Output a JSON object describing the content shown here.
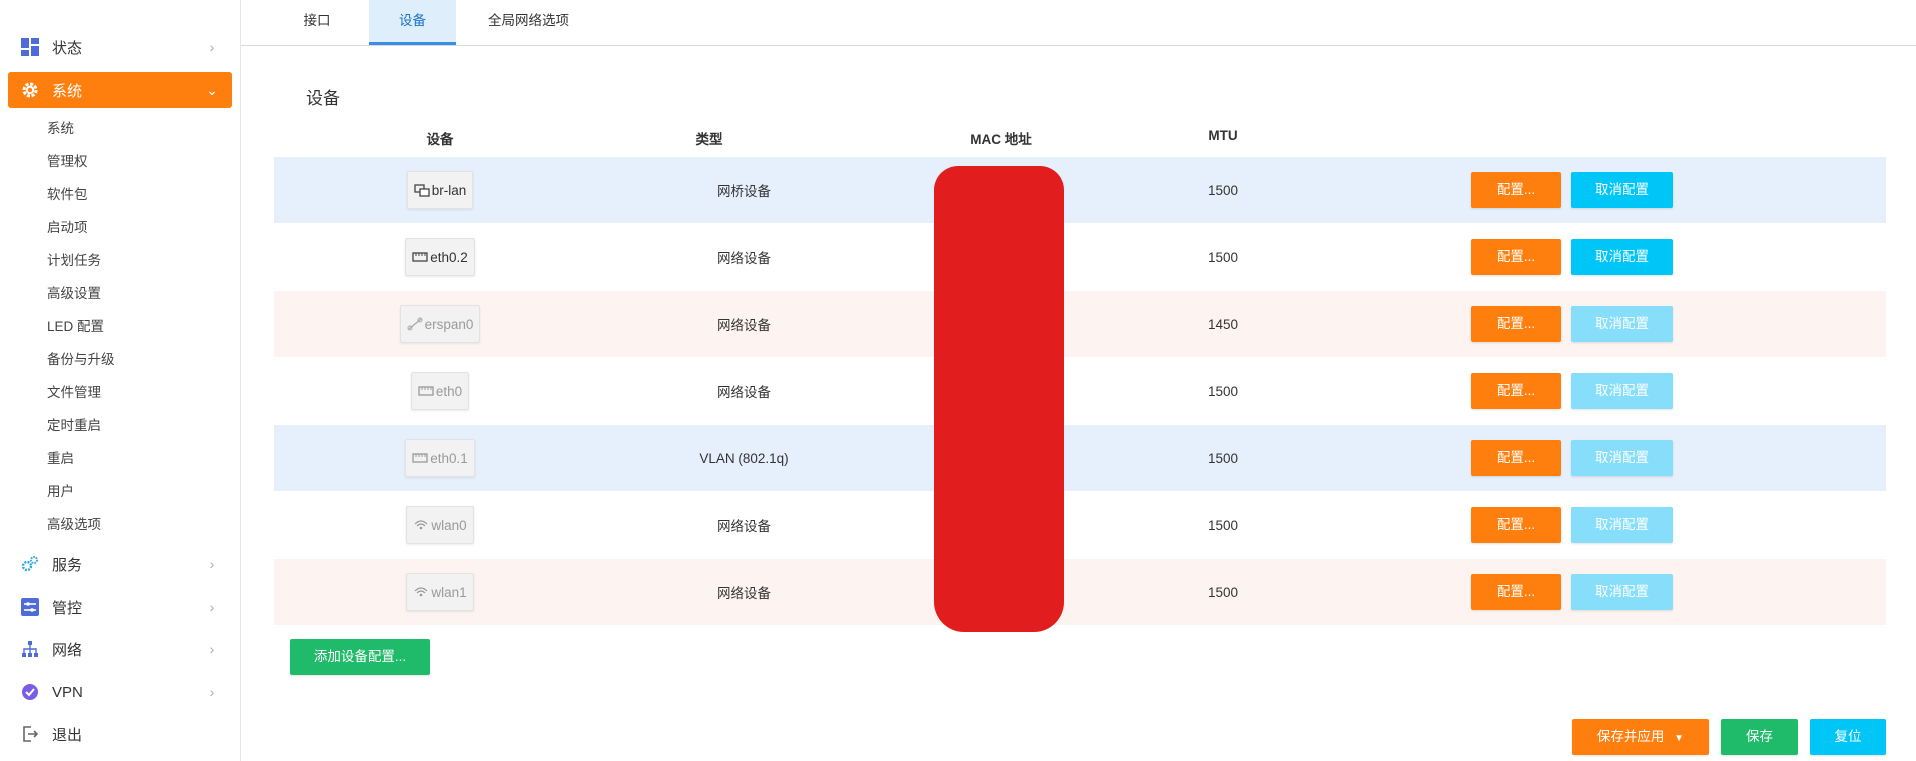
{
  "sidebar": {
    "top_items": [
      {
        "label": "状态",
        "icon": "dashboard-icon"
      },
      {
        "label": "系统",
        "icon": "gear-icon",
        "active": true
      },
      {
        "label": "服务",
        "icon": "gears-icon"
      },
      {
        "label": "管控",
        "icon": "sliders-icon"
      },
      {
        "label": "网络",
        "icon": "network-icon"
      },
      {
        "label": "VPN",
        "icon": "vpn-icon"
      },
      {
        "label": "退出",
        "icon": "logout-icon"
      }
    ],
    "sub_items": [
      "系统",
      "管理权",
      "软件包",
      "启动项",
      "计划任务",
      "高级设置",
      "LED 配置",
      "备份与升级",
      "文件管理",
      "定时重启",
      "重启",
      "用户",
      "高级选项"
    ]
  },
  "tabs": [
    "接口",
    "设备",
    "全局网络选项"
  ],
  "section_title": "设备",
  "table": {
    "headers": [
      "设备",
      "类型",
      "MAC 地址",
      "MTU"
    ],
    "rows": [
      {
        "device": "br-lan",
        "type": "网桥设备",
        "mtu": "1500"
      },
      {
        "device": "eth0.2",
        "type": "网络设备",
        "mtu": "1500"
      },
      {
        "device": "erspan0",
        "type": "网络设备",
        "mtu": "1450"
      },
      {
        "device": "eth0",
        "type": "网络设备",
        "mtu": "1500"
      },
      {
        "device": "eth0.1",
        "type": "VLAN (802.1q)",
        "mtu": "1500"
      },
      {
        "device": "wlan0",
        "type": "网络设备",
        "mtu": "1500"
      },
      {
        "device": "wlan1",
        "type": "网络设备",
        "mtu": "1500"
      }
    ],
    "configure_label": "配置...",
    "unconfigure_label": "取消配置"
  },
  "add_device_label": "添加设备配置...",
  "footer": {
    "save_apply_label": "保存并应用",
    "save_label": "保存",
    "reset_label": "复位"
  },
  "colors": {
    "accent": "#ff7f0e",
    "cyan": "#00c6f8",
    "green": "#1fba6a",
    "redaction": "#e21d1d"
  }
}
